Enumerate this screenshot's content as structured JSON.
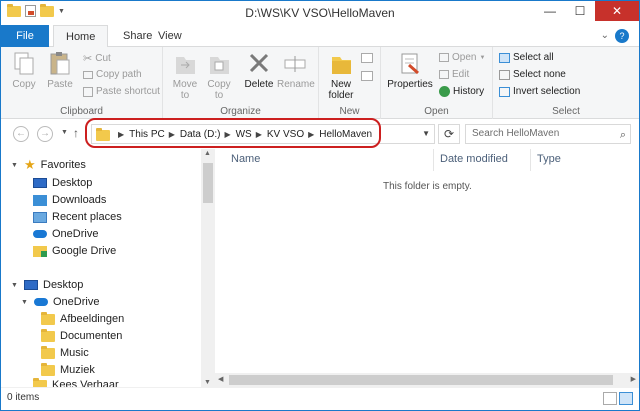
{
  "window": {
    "title": "D:\\WS\\KV VSO\\HelloMaven",
    "controls": {
      "minimize": "—",
      "maximize": "☐",
      "close": "✕"
    }
  },
  "tabs": {
    "file": "File",
    "home": "Home",
    "share": "Share",
    "view": "View"
  },
  "ribbon": {
    "clipboard": {
      "label": "Clipboard",
      "copy": "Copy",
      "paste": "Paste",
      "cut": "Cut",
      "copy_path": "Copy path",
      "paste_shortcut": "Paste shortcut"
    },
    "organize": {
      "label": "Organize",
      "move_to": "Move to",
      "copy_to": "Copy to",
      "delete": "Delete",
      "rename": "Rename"
    },
    "new": {
      "label": "New",
      "new_folder": "New folder"
    },
    "open": {
      "label": "Open",
      "properties": "Properties",
      "open": "Open",
      "edit": "Edit",
      "history": "History"
    },
    "select": {
      "label": "Select",
      "select_all": "Select all",
      "select_none": "Select none",
      "invert_selection": "Invert selection"
    }
  },
  "address": {
    "crumbs": [
      "This PC",
      "Data (D:)",
      "WS",
      "KV VSO",
      "HelloMaven"
    ],
    "search_placeholder": "Search HelloMaven"
  },
  "nav": {
    "favorites": "Favorites",
    "fav_items": [
      "Desktop",
      "Downloads",
      "Recent places",
      "OneDrive",
      "Google Drive"
    ],
    "desktop": "Desktop",
    "onedrive": "OneDrive",
    "onedrive_items": [
      "Afbeeldingen",
      "Documenten",
      "Music",
      "Muziek"
    ],
    "kees": "Kees Verhaar"
  },
  "columns": {
    "name": "Name",
    "date_modified": "Date modified",
    "type": "Type"
  },
  "content": {
    "empty_message": "This folder is empty."
  },
  "status": {
    "count": "0 items"
  },
  "colors": {
    "accent": "#1979ca",
    "highlight": "#cc1f1f",
    "close": "#c7312b"
  }
}
